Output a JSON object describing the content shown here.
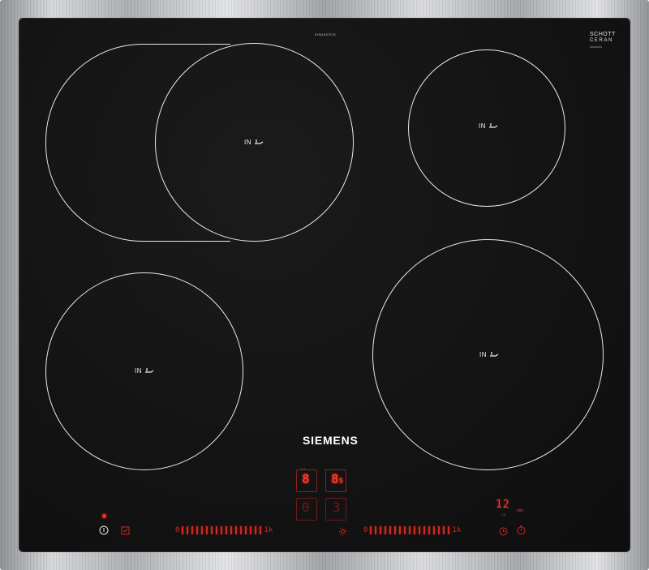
{
  "hob": {
    "model_text": "EH645JFE1E",
    "glass_brand": {
      "line1": "SCHOTT",
      "line2": "CERAN",
      "line3": "000000000"
    },
    "brand": "SIEMENS",
    "zone_label": "IN"
  },
  "display": {
    "top_left_label": "I-H",
    "top_left_digit": "8",
    "top_right_digit": "8",
    "top_right_sub": "5",
    "bottom_left_digit": "0",
    "bottom_right_digit": "3"
  },
  "timer": {
    "value": "12",
    "unit": "min",
    "label": "I-H"
  },
  "sliders": {
    "left": {
      "start": "0",
      "end": "1k"
    },
    "right": {
      "start": "0",
      "end": "1k"
    }
  },
  "icons": {
    "power": "power-icon",
    "lock": "child-lock-icon",
    "boost": "powerboost-icon",
    "timer": "timer-icon",
    "stopwatch": "stopwatch-icon"
  },
  "colors": {
    "glass": "#141415",
    "display_red": "#ff3a2a",
    "zone_line": "#e8e8e8"
  }
}
